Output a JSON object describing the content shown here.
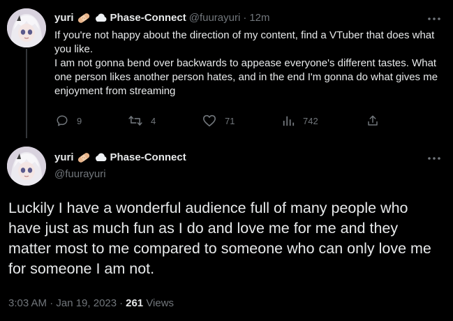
{
  "tweet1": {
    "display_name": "yuri",
    "org_name": "Phase-Connect",
    "handle": "@fuurayuri",
    "separator": "·",
    "time_ago": "12m",
    "text_line1": "If you're not happy about the direction of my content, find a VTuber that does what you like.",
    "text_line2": "I am not gonna bend over backwards to appease everyone's different tastes. What one person likes another person hates, and in the end I'm gonna do what gives me enjoyment from streaming",
    "actions": {
      "reply_count": "9",
      "retweet_count": "4",
      "like_count": "71",
      "views_count": "742"
    },
    "icons": [
      "bandage-icon",
      "cloud-icon",
      "more-icon",
      "reply-icon",
      "retweet-icon",
      "like-icon",
      "views-icon",
      "share-icon"
    ]
  },
  "tweet2": {
    "display_name": "yuri",
    "org_name": "Phase-Connect",
    "handle": "@fuurayuri",
    "text": "Luckily I have a wonderful audience full of many people who have just as much fun as I do and love me for me and they matter most to me compared to someone who can only love me for someone I am not.",
    "timestamp": "3:03 AM · Jan 19, 2023",
    "meta_separator": "·",
    "views_count": "261",
    "views_label": "Views"
  },
  "colors": {
    "background": "#000000",
    "text_primary": "#e7e9ea",
    "text_secondary": "#71767b",
    "thread_line": "#333639"
  }
}
